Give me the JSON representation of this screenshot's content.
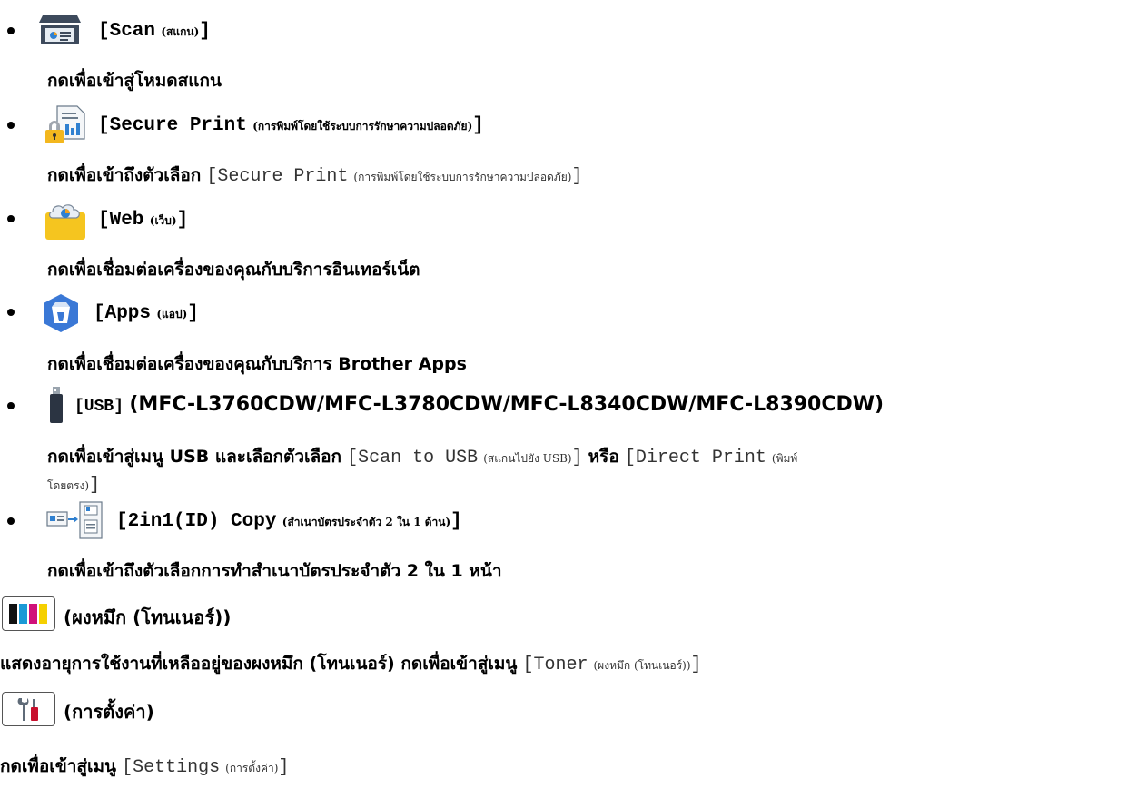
{
  "items": {
    "scan": {
      "label_open": "[Scan",
      "label_thai": "(สแกน)",
      "label_close": "]",
      "desc": "กดเพื่อเข้าสู่โหมดสแกน"
    },
    "secure_print": {
      "label_open": "[Secure Print",
      "label_thai": "(การพิมพ์โดยใช้ระบบการรักษาความปลอดภัย)",
      "label_close": "]",
      "desc_prefix": "กดเพื่อเข้าถึงตัวเลือก",
      "desc_code_open": "[Secure Print",
      "desc_code_thai": "(การพิมพ์โดยใช้ระบบการรักษาความปลอดภัย)",
      "desc_code_close": "]"
    },
    "web": {
      "label_open": "[Web",
      "label_thai": "(เว็บ)",
      "label_close": "]",
      "desc": "กดเพื่อเชื่อมต่อเครื่องของคุณกับบริการอินเทอร์เน็ต"
    },
    "apps": {
      "label_open": "[Apps",
      "label_thai": "(แอป)",
      "label_close": "]",
      "desc": "กดเพื่อเชื่อมต่อเครื่องของคุณกับบริการ Brother Apps"
    },
    "usb": {
      "label": "[USB]",
      "models": "(MFC-L3760CDW/MFC-L3780CDW/MFC-L8340CDW/MFC-L8390CDW)",
      "desc_prefix": "กดเพื่อเข้าสู่เมนู USB และเลือกตัวเลือก",
      "desc_code1_open": "[Scan to USB",
      "desc_code1_thai": "(สแกนไปยัง USB)",
      "desc_code1_close": "]",
      "desc_or": "หรือ",
      "desc_code2_open": "[Direct Print",
      "desc_code2_thai": "(พิมพ์",
      "desc_line2_thai": "โดยตรง)",
      "desc_line2_close": "]"
    },
    "copy2in1": {
      "label_open": "[2in1(ID) Copy",
      "label_thai": "(สำเนาบัตรประจำตัว 2 ใน 1 ด้าน)",
      "label_close": "]",
      "desc": "กดเพื่อเข้าถึงตัวเลือกการทำสำเนาบัตรประจำตัว 2 ใน 1 หน้า"
    }
  },
  "toner": {
    "heading": "(ผงหมึก (โทนเนอร์))",
    "desc_prefix": "แสดงอายุการใช้งานที่เหลืออยู่ของผงหมึก (โทนเนอร์) กดเพื่อเข้าสู่เมนู",
    "desc_code_open": "[Toner",
    "desc_code_thai": "(ผงหมึก (โทนเนอร์))",
    "desc_code_close": "]"
  },
  "settings": {
    "heading": "(การตั้งค่า)",
    "desc_prefix": "กดเพื่อเข้าสู่เมนู",
    "desc_code_open": "[Settings",
    "desc_code_thai": "(การตั้งค่า)",
    "desc_code_close": "]"
  },
  "colors": {
    "toner_cyan": "#1a9ad6",
    "toner_magenta": "#d0117a",
    "toner_yellow": "#f5d000",
    "toner_black": "#111111",
    "wrench_red": "#c8102e"
  }
}
